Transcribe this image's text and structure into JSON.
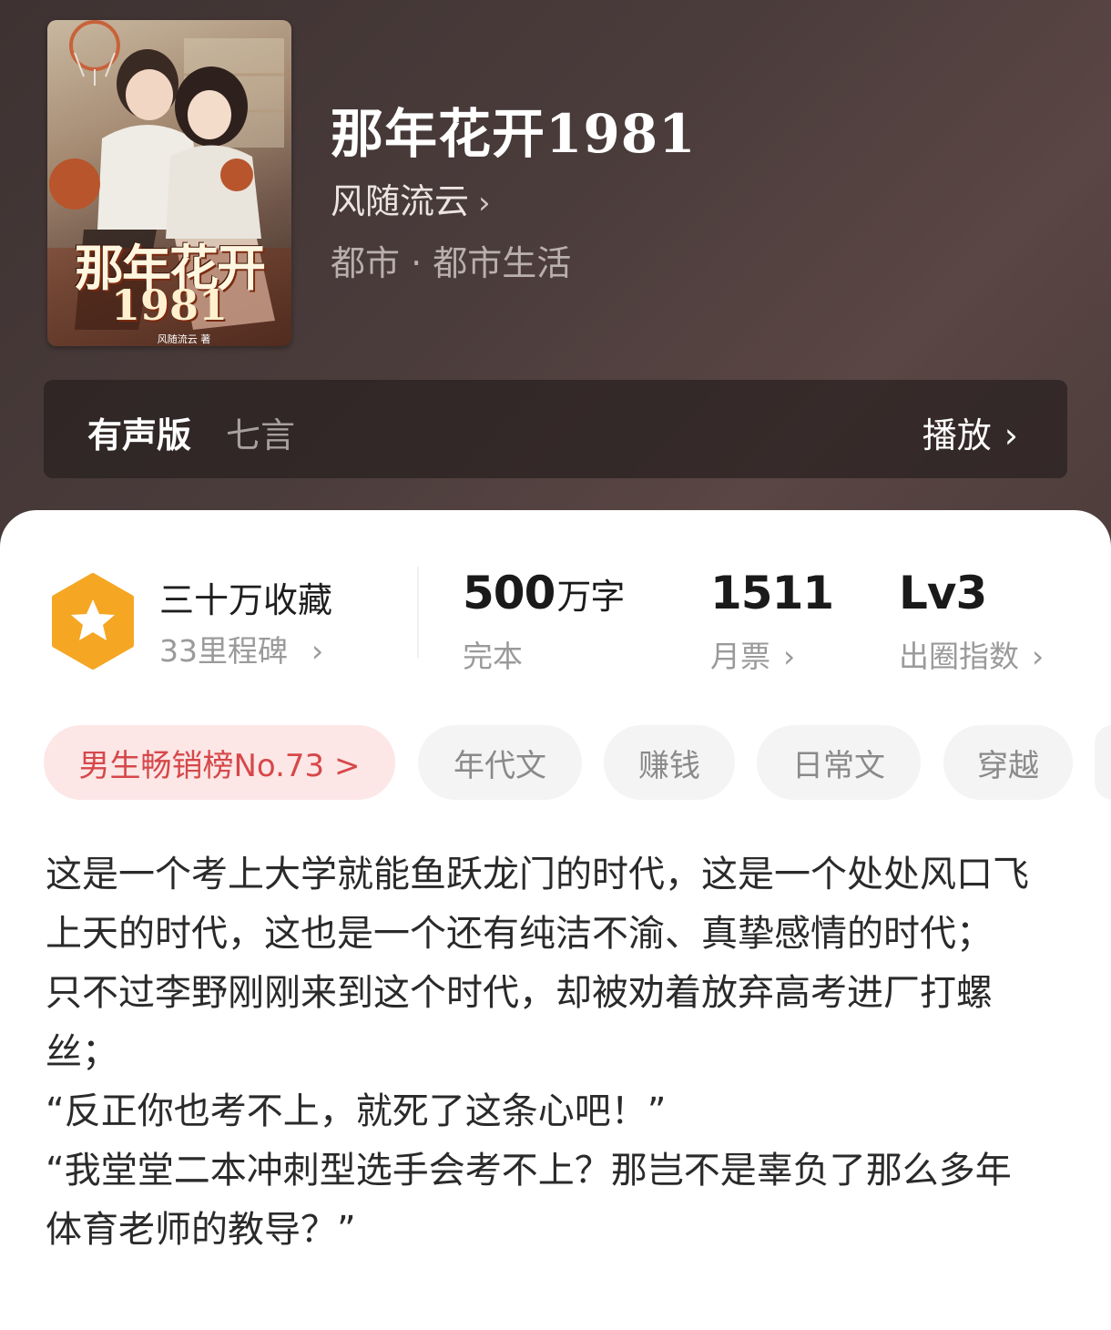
{
  "book": {
    "title": "那年花开1981",
    "author": "风随流云",
    "author_chevron": "›",
    "genre": "都市 · 都市生活",
    "cover": {
      "title_text": "那年花开",
      "year_text": "1981",
      "author_text": "风随流云 著"
    }
  },
  "audio": {
    "label": "有声版",
    "narrator": "七言",
    "play_label": "播放",
    "play_chevron": "›"
  },
  "stats": {
    "favorites": "三十万收藏",
    "milestone": "33里程碑",
    "milestone_chevron": "›",
    "word_count_number": "500",
    "word_count_unit": "万字",
    "status": "完本",
    "monthly_votes": "1511",
    "monthly_votes_label": "月票",
    "monthly_votes_chevron": "›",
    "level": "Lv3",
    "level_label": "出圈指数",
    "level_chevron": "›"
  },
  "tags": {
    "rank": "男生畅销榜No.73 >",
    "items": [
      "年代文",
      "赚钱",
      "日常文",
      "穿越"
    ]
  },
  "description": [
    "这是一个考上大学就能鱼跃龙门的时代，这是一个处处风口飞上天的时代，这也是一个还有纯洁不渝、真挚感情的时代；",
    "只不过李野刚刚来到这个时代，却被劝着放弃高考进厂打螺丝；",
    "“反正你也考不上，就死了这条心吧！”",
    "“我堂堂二本冲刺型选手会考不上？那岂不是辜负了那么多年体育老师的教导？”"
  ],
  "colors": {
    "header_bg": "#4a3c3b",
    "badge_orange": "#f5a623",
    "rank_tag_bg": "#fde6e6",
    "rank_tag_text": "#d6484a",
    "tag_bg": "#f4f4f4"
  }
}
